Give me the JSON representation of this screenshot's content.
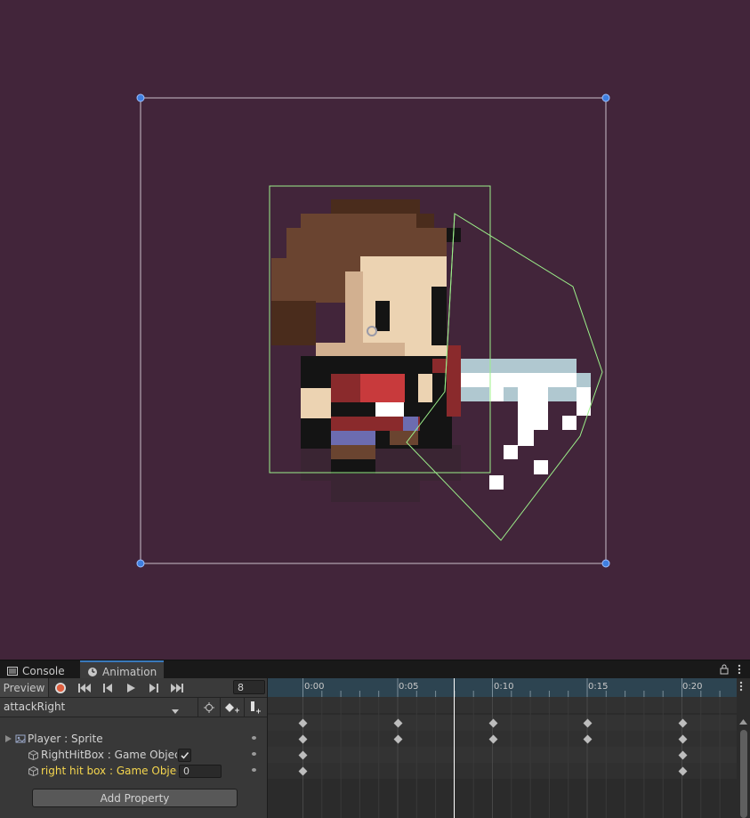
{
  "tabs": [
    {
      "label": "Console"
    },
    {
      "label": "Animation"
    }
  ],
  "toolbar": {
    "preview_label": "Preview",
    "frame_value": "8"
  },
  "clip": {
    "name": "attackRight"
  },
  "properties": [
    {
      "label": "Player : Sprite",
      "color": "#c4c4c4"
    },
    {
      "label": "RightHitBox : Game Object.I",
      "color": "#c4c4c4",
      "checked": true
    },
    {
      "label": "right hit box : Game Object.I",
      "color": "#f5d64e",
      "value": "0"
    }
  ],
  "add_property_label": "Add Property",
  "ruler": {
    "ticks": [
      "0:00",
      "0:05",
      "0:10",
      "0:15",
      "0:20"
    ]
  },
  "colors": {
    "scene_bg": "#42253a",
    "panel_bg": "#282828",
    "ruler_bg": "#2d4451",
    "accent": "#3a79bb",
    "record": "#e06040",
    "highlight_text": "#f5d64e",
    "collider": "#9cf08a"
  },
  "icons": {
    "record": "record-icon",
    "first": "first-key-icon",
    "prev": "prev-key-icon",
    "play": "play-icon",
    "next": "next-key-icon",
    "last": "last-key-icon",
    "dropdown": "dropdown-arrow-icon",
    "snap": "crosshair-icon",
    "add_key": "add-keyframe-icon",
    "add_event": "add-event-icon",
    "lock": "lock-icon",
    "menu": "kebab-menu-icon",
    "console": "console-icon",
    "animation": "clock-icon"
  }
}
